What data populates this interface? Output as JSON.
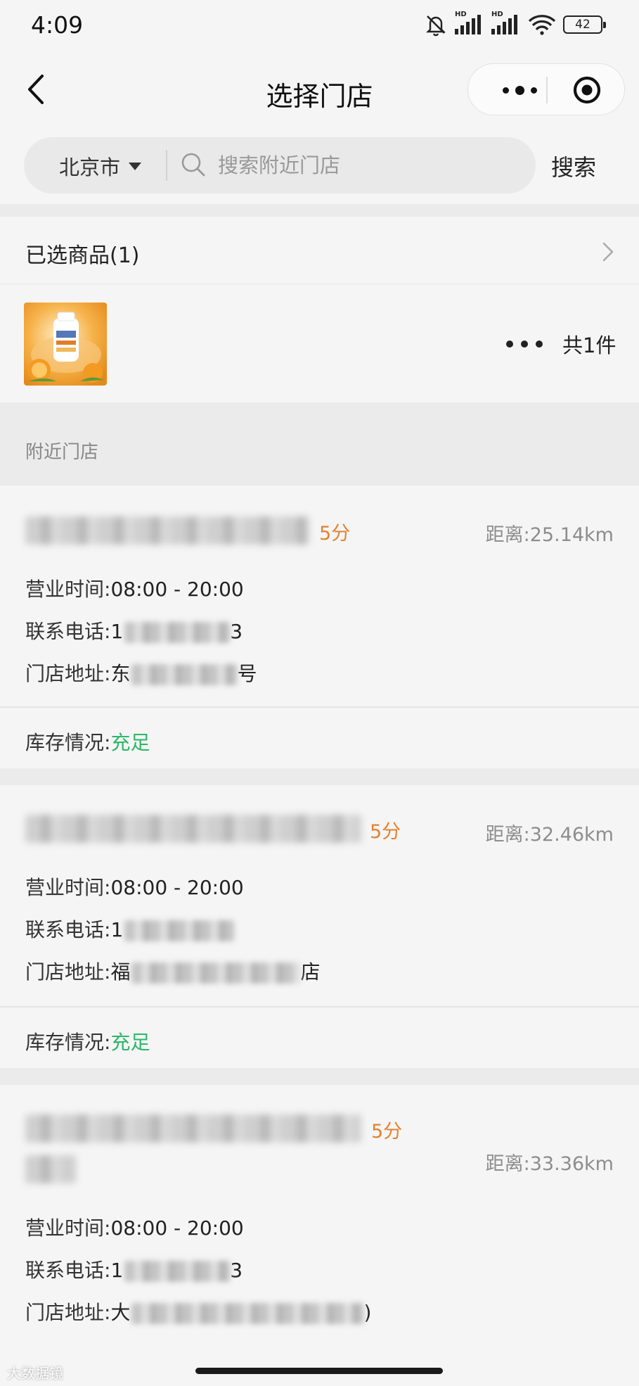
{
  "status_bar": {
    "time": "4:09",
    "battery": "42",
    "hd": "HD"
  },
  "nav": {
    "title": "选择门店"
  },
  "search": {
    "city": "北京市",
    "placeholder": "搜索附近门店",
    "button": "搜索"
  },
  "selected": {
    "title": "已选商品(1)",
    "count_label": "共1件"
  },
  "nearby_label": "附近门店",
  "stores": [
    {
      "score": "5分",
      "distance": "距离:25.14km",
      "hours_label": "营业时间:",
      "hours": "08:00 - 20:00",
      "phone_label": "联系电话:",
      "phone_prefix": "1",
      "phone_suffix": "3",
      "address_label": "门店地址:",
      "address_prefix": "东",
      "address_suffix": "号",
      "stock_label": "库存情况:",
      "stock": "充足"
    },
    {
      "score": "5分",
      "distance": "距离:32.46km",
      "hours_label": "营业时间:",
      "hours": "08:00 - 20:00",
      "phone_label": "联系电话:",
      "phone_prefix": "1",
      "phone_suffix": "",
      "address_label": "门店地址:",
      "address_prefix": "福",
      "address_suffix": "店",
      "stock_label": "库存情况:",
      "stock": "充足"
    },
    {
      "score": "5分",
      "distance": "距离:33.36km",
      "hours_label": "营业时间:",
      "hours": "08:00 - 20:00",
      "phone_label": "联系电话:",
      "phone_prefix": "1",
      "phone_suffix": "3",
      "address_label": "门店地址:",
      "address_prefix": "大",
      "address_suffix": ")"
    }
  ],
  "watermark": "大数据镜",
  "colors": {
    "score": "#e5812f",
    "stock_ok": "#2db669",
    "muted": "#8d8d8d"
  }
}
